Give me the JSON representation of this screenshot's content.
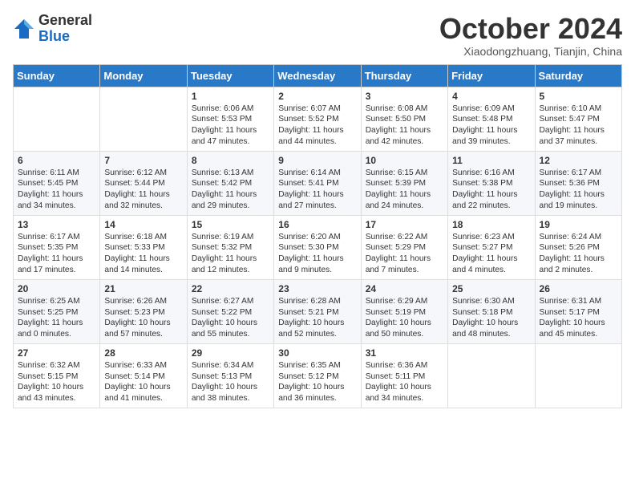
{
  "logo": {
    "general": "General",
    "blue": "Blue"
  },
  "header": {
    "month": "October 2024",
    "location": "Xiaodongzhuang, Tianjin, China"
  },
  "weekdays": [
    "Sunday",
    "Monday",
    "Tuesday",
    "Wednesday",
    "Thursday",
    "Friday",
    "Saturday"
  ],
  "weeks": [
    [
      null,
      null,
      {
        "day": 1,
        "sunrise": "Sunrise: 6:06 AM",
        "sunset": "Sunset: 5:53 PM",
        "daylight": "Daylight: 11 hours and 47 minutes."
      },
      {
        "day": 2,
        "sunrise": "Sunrise: 6:07 AM",
        "sunset": "Sunset: 5:52 PM",
        "daylight": "Daylight: 11 hours and 44 minutes."
      },
      {
        "day": 3,
        "sunrise": "Sunrise: 6:08 AM",
        "sunset": "Sunset: 5:50 PM",
        "daylight": "Daylight: 11 hours and 42 minutes."
      },
      {
        "day": 4,
        "sunrise": "Sunrise: 6:09 AM",
        "sunset": "Sunset: 5:48 PM",
        "daylight": "Daylight: 11 hours and 39 minutes."
      },
      {
        "day": 5,
        "sunrise": "Sunrise: 6:10 AM",
        "sunset": "Sunset: 5:47 PM",
        "daylight": "Daylight: 11 hours and 37 minutes."
      }
    ],
    [
      {
        "day": 6,
        "sunrise": "Sunrise: 6:11 AM",
        "sunset": "Sunset: 5:45 PM",
        "daylight": "Daylight: 11 hours and 34 minutes."
      },
      {
        "day": 7,
        "sunrise": "Sunrise: 6:12 AM",
        "sunset": "Sunset: 5:44 PM",
        "daylight": "Daylight: 11 hours and 32 minutes."
      },
      {
        "day": 8,
        "sunrise": "Sunrise: 6:13 AM",
        "sunset": "Sunset: 5:42 PM",
        "daylight": "Daylight: 11 hours and 29 minutes."
      },
      {
        "day": 9,
        "sunrise": "Sunrise: 6:14 AM",
        "sunset": "Sunset: 5:41 PM",
        "daylight": "Daylight: 11 hours and 27 minutes."
      },
      {
        "day": 10,
        "sunrise": "Sunrise: 6:15 AM",
        "sunset": "Sunset: 5:39 PM",
        "daylight": "Daylight: 11 hours and 24 minutes."
      },
      {
        "day": 11,
        "sunrise": "Sunrise: 6:16 AM",
        "sunset": "Sunset: 5:38 PM",
        "daylight": "Daylight: 11 hours and 22 minutes."
      },
      {
        "day": 12,
        "sunrise": "Sunrise: 6:17 AM",
        "sunset": "Sunset: 5:36 PM",
        "daylight": "Daylight: 11 hours and 19 minutes."
      }
    ],
    [
      {
        "day": 13,
        "sunrise": "Sunrise: 6:17 AM",
        "sunset": "Sunset: 5:35 PM",
        "daylight": "Daylight: 11 hours and 17 minutes."
      },
      {
        "day": 14,
        "sunrise": "Sunrise: 6:18 AM",
        "sunset": "Sunset: 5:33 PM",
        "daylight": "Daylight: 11 hours and 14 minutes."
      },
      {
        "day": 15,
        "sunrise": "Sunrise: 6:19 AM",
        "sunset": "Sunset: 5:32 PM",
        "daylight": "Daylight: 11 hours and 12 minutes."
      },
      {
        "day": 16,
        "sunrise": "Sunrise: 6:20 AM",
        "sunset": "Sunset: 5:30 PM",
        "daylight": "Daylight: 11 hours and 9 minutes."
      },
      {
        "day": 17,
        "sunrise": "Sunrise: 6:22 AM",
        "sunset": "Sunset: 5:29 PM",
        "daylight": "Daylight: 11 hours and 7 minutes."
      },
      {
        "day": 18,
        "sunrise": "Sunrise: 6:23 AM",
        "sunset": "Sunset: 5:27 PM",
        "daylight": "Daylight: 11 hours and 4 minutes."
      },
      {
        "day": 19,
        "sunrise": "Sunrise: 6:24 AM",
        "sunset": "Sunset: 5:26 PM",
        "daylight": "Daylight: 11 hours and 2 minutes."
      }
    ],
    [
      {
        "day": 20,
        "sunrise": "Sunrise: 6:25 AM",
        "sunset": "Sunset: 5:25 PM",
        "daylight": "Daylight: 11 hours and 0 minutes."
      },
      {
        "day": 21,
        "sunrise": "Sunrise: 6:26 AM",
        "sunset": "Sunset: 5:23 PM",
        "daylight": "Daylight: 10 hours and 57 minutes."
      },
      {
        "day": 22,
        "sunrise": "Sunrise: 6:27 AM",
        "sunset": "Sunset: 5:22 PM",
        "daylight": "Daylight: 10 hours and 55 minutes."
      },
      {
        "day": 23,
        "sunrise": "Sunrise: 6:28 AM",
        "sunset": "Sunset: 5:21 PM",
        "daylight": "Daylight: 10 hours and 52 minutes."
      },
      {
        "day": 24,
        "sunrise": "Sunrise: 6:29 AM",
        "sunset": "Sunset: 5:19 PM",
        "daylight": "Daylight: 10 hours and 50 minutes."
      },
      {
        "day": 25,
        "sunrise": "Sunrise: 6:30 AM",
        "sunset": "Sunset: 5:18 PM",
        "daylight": "Daylight: 10 hours and 48 minutes."
      },
      {
        "day": 26,
        "sunrise": "Sunrise: 6:31 AM",
        "sunset": "Sunset: 5:17 PM",
        "daylight": "Daylight: 10 hours and 45 minutes."
      }
    ],
    [
      {
        "day": 27,
        "sunrise": "Sunrise: 6:32 AM",
        "sunset": "Sunset: 5:15 PM",
        "daylight": "Daylight: 10 hours and 43 minutes."
      },
      {
        "day": 28,
        "sunrise": "Sunrise: 6:33 AM",
        "sunset": "Sunset: 5:14 PM",
        "daylight": "Daylight: 10 hours and 41 minutes."
      },
      {
        "day": 29,
        "sunrise": "Sunrise: 6:34 AM",
        "sunset": "Sunset: 5:13 PM",
        "daylight": "Daylight: 10 hours and 38 minutes."
      },
      {
        "day": 30,
        "sunrise": "Sunrise: 6:35 AM",
        "sunset": "Sunset: 5:12 PM",
        "daylight": "Daylight: 10 hours and 36 minutes."
      },
      {
        "day": 31,
        "sunrise": "Sunrise: 6:36 AM",
        "sunset": "Sunset: 5:11 PM",
        "daylight": "Daylight: 10 hours and 34 minutes."
      },
      null,
      null
    ]
  ]
}
